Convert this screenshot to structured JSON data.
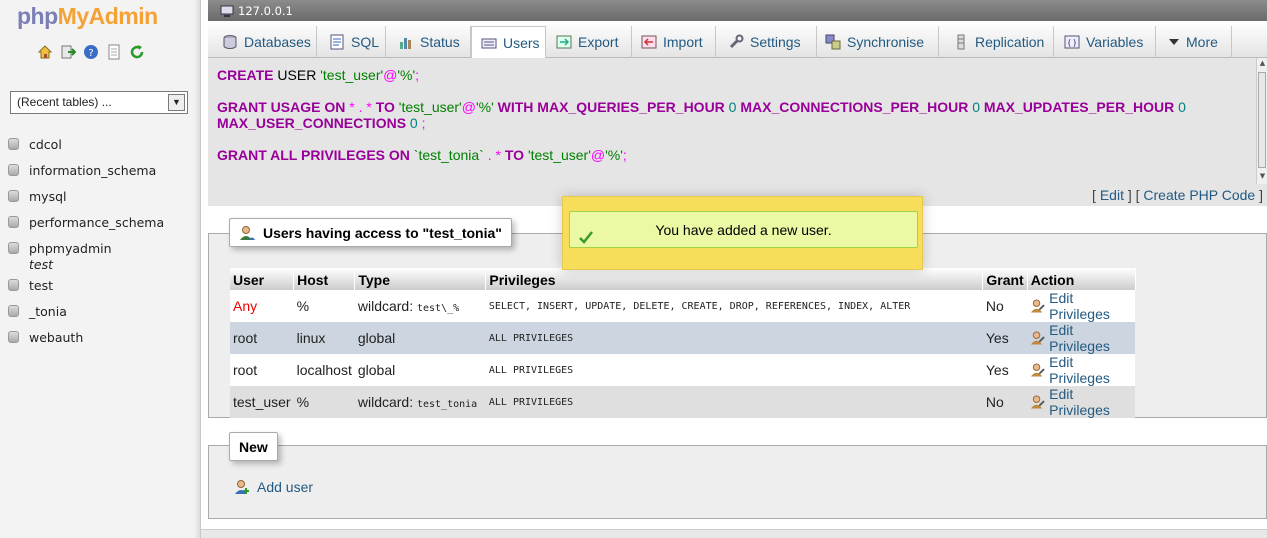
{
  "nav": {
    "logo_php": "php",
    "logo_myadmin": "MyAdmin",
    "icons": [
      "home-icon",
      "exit-icon",
      "help-icon",
      "docs-icon",
      "reload-icon"
    ],
    "recent_tables": "(Recent tables) ...",
    "databases": [
      {
        "name": "cdcol",
        "sub": false
      },
      {
        "name": "information_schema",
        "sub": false
      },
      {
        "name": "mysql",
        "sub": false
      },
      {
        "name": "performance_schema",
        "sub": false
      },
      {
        "name": "phpmyadmin",
        "sub": false
      },
      {
        "name": "test",
        "sub": true
      },
      {
        "name": "test",
        "sub": false
      },
      {
        "name": "_tonia",
        "sub": false
      },
      {
        "name": "webauth",
        "sub": false
      }
    ]
  },
  "server": {
    "label": "127.0.0.1"
  },
  "tabs": [
    {
      "label": "Databases",
      "icon": "database-icon"
    },
    {
      "label": "SQL",
      "icon": "sql-icon"
    },
    {
      "label": "Status",
      "icon": "status-icon"
    },
    {
      "label": "Users",
      "icon": "users-icon",
      "active": true
    },
    {
      "label": "Export",
      "icon": "export-icon"
    },
    {
      "label": "Import",
      "icon": "import-icon"
    },
    {
      "label": "Settings",
      "icon": "settings-icon"
    },
    {
      "label": "Synchronise",
      "icon": "synchronise-icon"
    },
    {
      "label": "Replication",
      "icon": "replication-icon"
    },
    {
      "label": "Variables",
      "icon": "variables-icon"
    },
    {
      "label": "More",
      "icon": "more-icon"
    }
  ],
  "sql": {
    "l1_create_user": "CREATE",
    "l1_user": " USER ",
    "l1_name": "'test_user'",
    "l1_at": "@",
    "l1_host": "'%'",
    "l1_semi": ";",
    "l2_grant_usage_on": "GRANT USAGE ON",
    "l2_star1": " * ",
    "l2_dot": ".",
    "l2_star2": " * ",
    "l2_to": "TO",
    "l2_name": " 'test_user'",
    "l2_at": "@",
    "l2_host": "'%'",
    "l2_with": " WITH MAX_QUERIES_PER_HOUR",
    "l2_zero1": " 0 ",
    "l2_maxconn": "MAX_CONNECTIONS_PER_HOUR",
    "l2_zero2": " 0 ",
    "l2_maxupd": "MAX_UPDATES_PER_HOUR",
    "l2_zero3": " 0",
    "l2_maxuser": "MAX_USER_CONNECTIONS",
    "l2_zero4": " 0 ",
    "l2_semi": ";",
    "l3_grant_all": "GRANT ALL PRIVILEGES ON",
    "l3_db": " `test_tonia` ",
    "l3_dot": ".",
    "l3_star": " * ",
    "l3_to": "TO",
    "l3_name": " 'test_user'",
    "l3_at": "@",
    "l3_host": "'%'",
    "l3_semi": ";",
    "edit": "Edit",
    "create_php": "Create PHP Code",
    "bracket_open": "[ ",
    "bracket_close": " ]"
  },
  "users_access": {
    "legend": "Users having access to \"test_tonia\"",
    "columns": [
      "User",
      "Host",
      "Type",
      "Privileges",
      "Grant",
      "Action"
    ],
    "rows": [
      {
        "user": "Any",
        "host": "%",
        "type": "wildcard:",
        "type_code": "test\\_%",
        "privileges": "SELECT, INSERT, UPDATE, DELETE, CREATE, DROP, REFERENCES, INDEX, ALTER",
        "grant": "No",
        "action": "Edit Privileges"
      },
      {
        "user": "root",
        "host": "linux",
        "type": "global",
        "type_code": "",
        "privileges": "ALL PRIVILEGES",
        "grant": "Yes",
        "action": "Edit Privileges"
      },
      {
        "user": "root",
        "host": "localhost",
        "type": "global",
        "type_code": "",
        "privileges": "ALL PRIVILEGES",
        "grant": "Yes",
        "action": "Edit Privileges"
      },
      {
        "user": "test_user",
        "host": "%",
        "type": "wildcard:",
        "type_code": "test_tonia",
        "privileges": "ALL PRIVILEGES",
        "grant": "No",
        "action": "Edit Privileges"
      }
    ]
  },
  "notice": {
    "message": "You have added a new user."
  },
  "new_section": {
    "legend": "New",
    "add_user": "Add user"
  }
}
